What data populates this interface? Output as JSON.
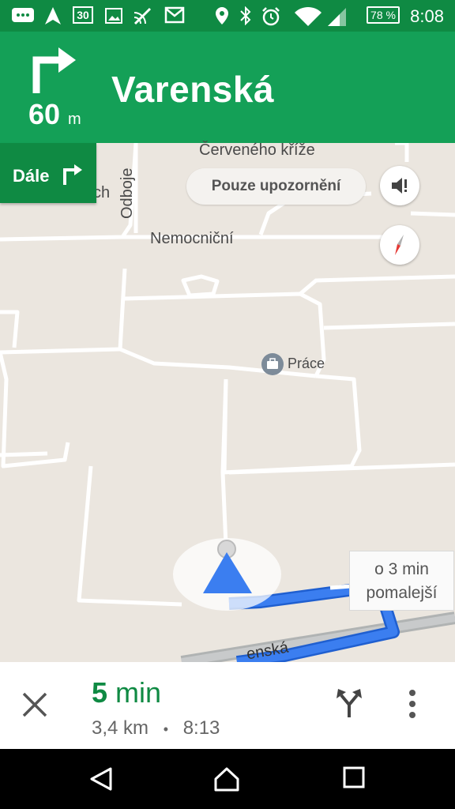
{
  "status_bar": {
    "calendar_day": "30",
    "battery_percent": "78 %",
    "time": "8:08",
    "icons": [
      "message-icon",
      "navigation-icon",
      "calendar-icon",
      "image-icon",
      "cast-icon",
      "gmail-icon",
      "location-icon",
      "bluetooth-icon",
      "alarm-icon",
      "wifi-icon",
      "signal-icon",
      "battery-icon"
    ]
  },
  "nav": {
    "distance_value": "60",
    "distance_unit": "m",
    "street": "Varenská",
    "then_label": "Dále"
  },
  "map": {
    "labels": {
      "cerveneho_krize": "Červeného kříže",
      "odboje": "Odboje",
      "ch_fragment": "ch",
      "nemocnicni": "Nemocniční",
      "prace": "Práce",
      "varenska_fragment": "enská"
    },
    "alerts_only": "Pouze upozornění",
    "alt_route_line1": "o 3 min",
    "alt_route_line2": "pomalejší",
    "route_color": "#3b7ef0"
  },
  "trip": {
    "eta_value": "5",
    "eta_unit": "min",
    "distance": "3,4 km",
    "separator": "•",
    "arrival_time": "8:13"
  },
  "colors": {
    "header_green": "#14a057",
    "dark_green": "#0f8a43",
    "eta_green": "#0f8a43"
  }
}
